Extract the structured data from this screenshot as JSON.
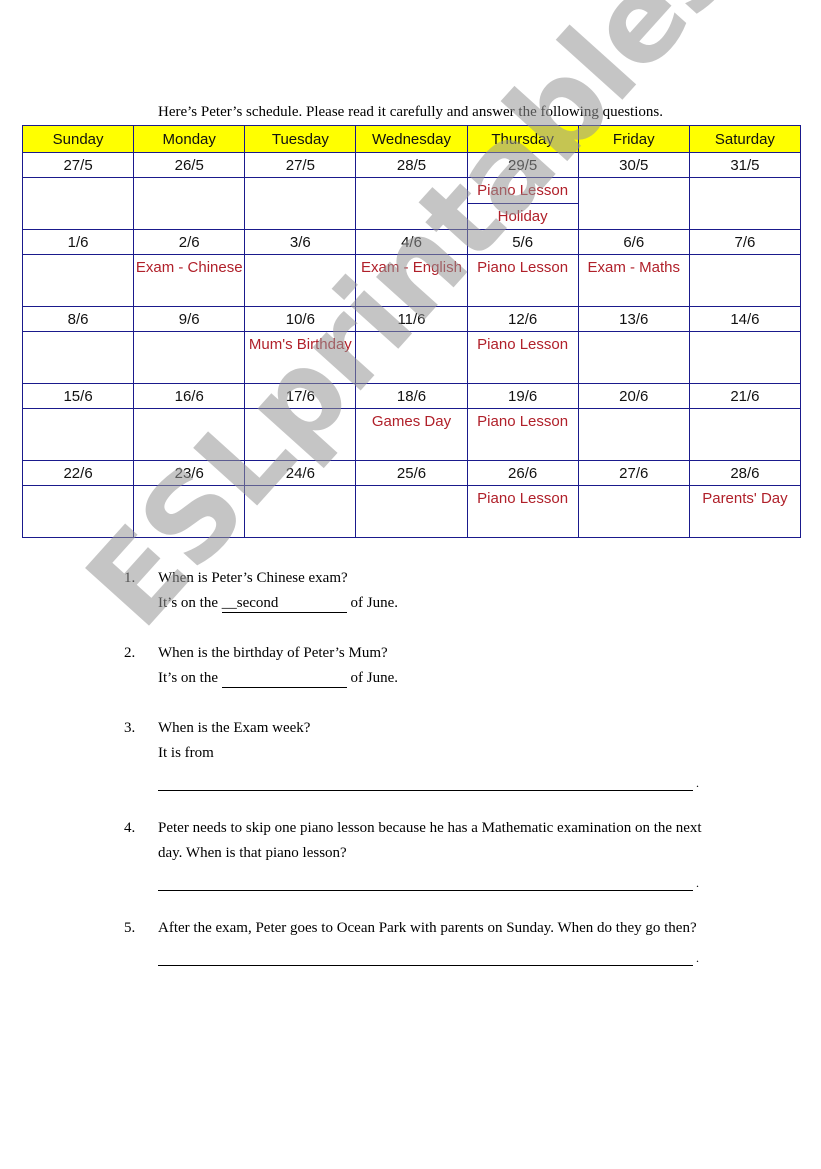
{
  "intro": "Here’s Peter’s schedule. Please read it carefully and answer the following questions.",
  "days": [
    "Sunday",
    "Monday",
    "Tuesday",
    "Wednesday",
    "Thursday",
    "Friday",
    "Saturday"
  ],
  "weeks": [
    {
      "dates": [
        "27/5",
        "26/5",
        "27/5",
        "28/5",
        "29/5",
        "30/5",
        "31/5"
      ],
      "events": [
        "",
        "",
        "",
        "",
        [
          "Piano Lesson",
          "Holiday"
        ],
        "",
        ""
      ]
    },
    {
      "dates": [
        "1/6",
        "2/6",
        "3/6",
        "4/6",
        "5/6",
        "6/6",
        "7/6"
      ],
      "events": [
        "",
        "Exam - Chinese",
        "",
        "Exam - English",
        "Piano Lesson",
        "Exam - Maths",
        ""
      ]
    },
    {
      "dates": [
        "8/6",
        "9/6",
        "10/6",
        "11/6",
        "12/6",
        "13/6",
        "14/6"
      ],
      "events": [
        "",
        "",
        "Mum's Birthday",
        "",
        "Piano Lesson",
        "",
        ""
      ]
    },
    {
      "dates": [
        "15/6",
        "16/6",
        "17/6",
        "18/6",
        "19/6",
        "20/6",
        "21/6"
      ],
      "events": [
        "",
        "",
        "",
        "Games Day",
        "Piano Lesson",
        "",
        ""
      ]
    },
    {
      "dates": [
        "22/6",
        "23/6",
        "24/6",
        "25/6",
        "26/6",
        "27/6",
        "28/6"
      ],
      "events": [
        "",
        "",
        "",
        "",
        "Piano Lesson",
        "",
        "Parents' Day"
      ]
    }
  ],
  "questions": [
    {
      "num": "1.",
      "text": "When is Peter’s Chinese exam?",
      "answer_prefix": "It’s on the",
      "answer_value": "__second",
      "answer_suffix": "of June."
    },
    {
      "num": "2.",
      "text": "When is the birthday of Peter’s Mum?",
      "answer_prefix": "It’s on the",
      "answer_value": "",
      "answer_suffix": "of June."
    },
    {
      "num": "3.",
      "text": "When is the Exam week?",
      "answer_prefix": "It is from"
    },
    {
      "num": "4.",
      "text": "Peter needs to skip one piano lesson because he has a Mathematic examination on the next day. When is that piano lesson?"
    },
    {
      "num": "5.",
      "text": "After the exam, Peter goes to Ocean Park with parents on Sunday. When do they go then?"
    }
  ],
  "watermark": "ESLprintables.com",
  "colors": {
    "header_bg": "#ffff00",
    "border": "#1a1a8c",
    "event_text": "#b0202a"
  }
}
